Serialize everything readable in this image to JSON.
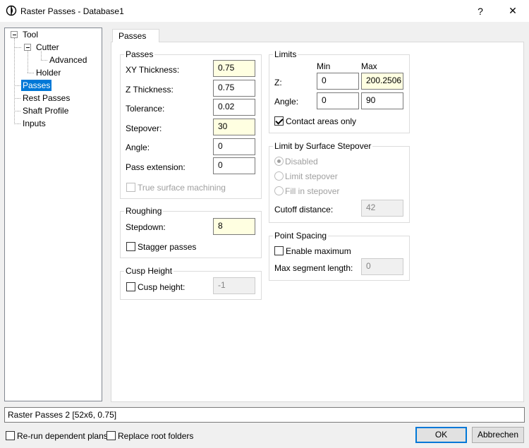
{
  "window": {
    "title": "Raster Passes - Database1",
    "help_label": "?",
    "close_label": "✕"
  },
  "tree": {
    "items": [
      {
        "label": "Tool"
      },
      {
        "label": "Cutter"
      },
      {
        "label": "Advanced"
      },
      {
        "label": "Holder"
      },
      {
        "label": "Passes",
        "selected": true
      },
      {
        "label": "Rest Passes"
      },
      {
        "label": "Shaft Profile"
      },
      {
        "label": "Inputs"
      }
    ]
  },
  "tab": {
    "label": "Passes"
  },
  "passes_group": {
    "title": "Passes",
    "xy_thickness": {
      "label": "XY Thickness:",
      "value": "0.75"
    },
    "z_thickness": {
      "label": "Z Thickness:",
      "value": "0.75"
    },
    "tolerance": {
      "label": "Tolerance:",
      "value": "0.02"
    },
    "stepover": {
      "label": "Stepover:",
      "value": "30"
    },
    "angle": {
      "label": "Angle:",
      "value": "0"
    },
    "pass_extension": {
      "label": "Pass extension:",
      "value": "0"
    },
    "true_surface": {
      "label": "True surface machining",
      "checked": false
    }
  },
  "roughing_group": {
    "title": "Roughing",
    "stepdown": {
      "label": "Stepdown:",
      "value": "8"
    },
    "stagger": {
      "label": "Stagger passes",
      "checked": false
    }
  },
  "cusp_group": {
    "title": "Cusp Height",
    "cusp": {
      "label": "Cusp height:",
      "checked": false,
      "value": "-1"
    }
  },
  "limits_group": {
    "title": "Limits",
    "min_header": "Min",
    "max_header": "Max",
    "z": {
      "label": "Z:",
      "min": "0",
      "max": "200.2506"
    },
    "angle": {
      "label": "Angle:",
      "min": "0",
      "max": "90"
    },
    "contact": {
      "label": "Contact areas only",
      "checked": true
    }
  },
  "surface_stepover_group": {
    "title": "Limit by Surface Stepover",
    "disabled_option": {
      "label": "Disabled",
      "selected": true
    },
    "limit_option": {
      "label": "Limit stepover",
      "selected": false
    },
    "fill_option": {
      "label": "Fill in stepover",
      "selected": false
    },
    "cutoff": {
      "label": "Cutoff distance:",
      "value": "42"
    }
  },
  "point_spacing_group": {
    "title": "Point Spacing",
    "enable_max": {
      "label": "Enable maximum",
      "checked": false
    },
    "max_segment": {
      "label": "Max segment length:",
      "value": "0"
    }
  },
  "status": {
    "text": "Raster Passes 2 [52x6, 0.75]"
  },
  "footer": {
    "rerun": {
      "label": "Re-run dependent plans",
      "checked": false
    },
    "replace": {
      "label": "Replace root folders",
      "checked": false
    },
    "ok_label": "OK",
    "cancel_label": "Abbrechen"
  },
  "colors": {
    "selection": "#0078d7",
    "highlight_field": "#ffffe1",
    "window_bg": "#f0f0f0"
  }
}
